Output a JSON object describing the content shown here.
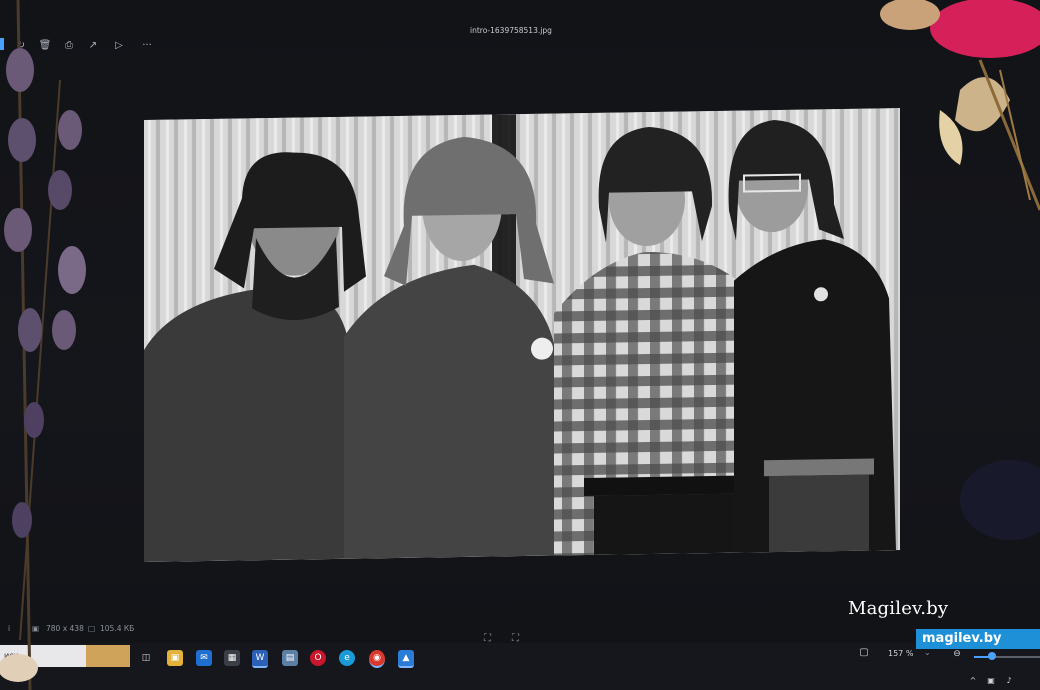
{
  "window": {
    "file_title": "intro-1639758513.jpg"
  },
  "toolbar": {
    "buttons": [
      {
        "icon": "rotate-icon"
      },
      {
        "icon": "delete-icon"
      },
      {
        "icon": "print-icon"
      },
      {
        "icon": "share-icon"
      },
      {
        "icon": "slideshow-icon"
      },
      {
        "icon": "more-icon",
        "label": "···"
      }
    ]
  },
  "photo": {
    "description_icon": "band-photo-image"
  },
  "status_bar": {
    "info_glyph": "i",
    "dimensions": "780 x 438",
    "file_size": "105.4 КБ"
  },
  "view_controls": {
    "zoom_percent": "157 %",
    "zoom_slider_fraction": 0.28
  },
  "taskbar": {
    "search_label": "иск",
    "apps": [
      "file-explorer-icon",
      "mail-icon",
      "store-icon",
      "word-icon",
      "notepad-icon",
      "opera-icon",
      "edge-icon",
      "chrome-icon",
      "photos-icon"
    ]
  },
  "watermarks": {
    "serif_text": "Magilev.by",
    "badge_text": "magilev.by"
  },
  "colors": {
    "accent": "#4aa0ff",
    "badge": "#1e90d8"
  }
}
